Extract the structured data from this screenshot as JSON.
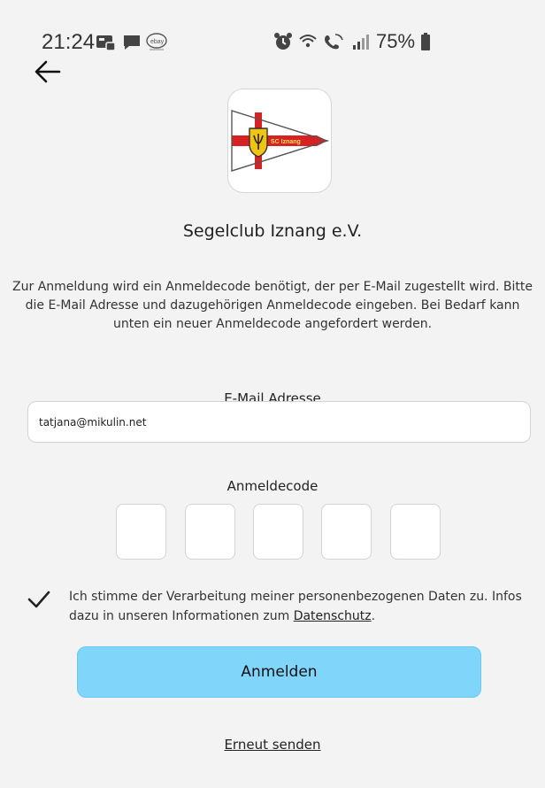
{
  "status_bar": {
    "time": "21:24",
    "battery": "75%",
    "icons_left": [
      "message-app-icon",
      "chat-icon",
      "ebay-icon"
    ],
    "icons_right": [
      "alarm-icon",
      "wifi-icon",
      "wifi-calling-icon",
      "signal-icon",
      "battery-icon"
    ]
  },
  "header": {
    "back_icon": "arrow-left-icon"
  },
  "club": {
    "name": "Segelclub Iznang e.V.",
    "logo_text": "SC Iznang"
  },
  "intro_text": "Zur Anmeldung wird ein Anmeldecode benötigt, der per E-Mail zugestellt wird. Bitte die E-Mail Adresse und dazugehörigen Anmeldecode eingeben. Bei Bedarf kann unten ein neuer Anmeldecode angefordert werden.",
  "email": {
    "label": "E-Mail Adresse",
    "value": "tatjana@mikulin.net"
  },
  "code": {
    "label": "Anmeldecode",
    "digits": [
      "",
      "",
      "",
      "",
      ""
    ]
  },
  "consent": {
    "checked": true,
    "text_prefix": "Ich stimme der Verarbeitung meiner personenbezogenen Daten zu. Infos dazu in unseren Informationen zum ",
    "link_text": "Datenschutz",
    "text_suffix": "."
  },
  "buttons": {
    "login_label": "Anmelden",
    "resend_label": "Erneut senden"
  },
  "colors": {
    "background": "#f3f3f3",
    "accent_button": "#7fd5fa",
    "logo_red": "#d62222",
    "logo_yellow": "#f1c40f"
  }
}
